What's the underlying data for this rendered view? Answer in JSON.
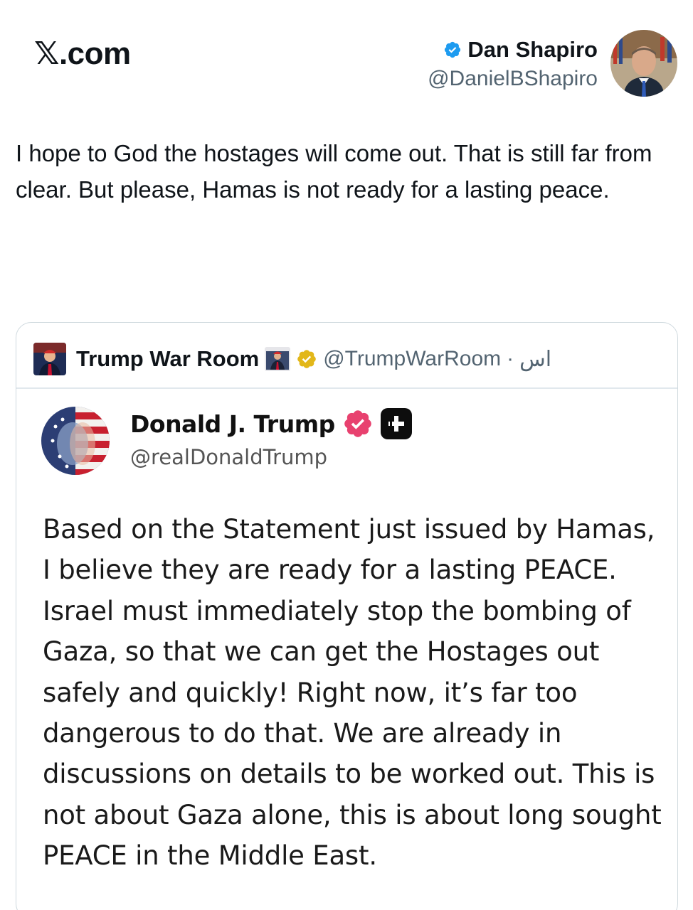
{
  "site": {
    "title": "𝕏.com"
  },
  "author": {
    "name": "Dan Shapiro",
    "handle": "@DanielBShapiro",
    "verified": "blue-check-icon",
    "accent": "#1d9bf0"
  },
  "tweet": {
    "text": "I hope to God the hostages will come out. That is still far from clear. But please, Hamas is not ready for a lasting peace."
  },
  "quote": {
    "name": "Trump War Room",
    "handle": "@TrumpWarRoom",
    "separator": "·",
    "time": "اس",
    "verified": "gold-check-icon",
    "accent": "#e2b719"
  },
  "truth_post": {
    "name": "Donald J. Trump",
    "handle": "@realDonaldTrump",
    "verified": "pink-check-icon",
    "accent": "#e8416f",
    "body": "Based on the Statement just issued by Hamas, I believe they are ready for a lasting PEACE. Israel must immediately stop the bombing of Gaza, so that we can get the Hostages out safely and quickly! Right now, it’s far too dangerous to do that. We are already in discussions on details to be worked out. This is not about Gaza alone, this is about long sought PEACE in the Middle East."
  }
}
